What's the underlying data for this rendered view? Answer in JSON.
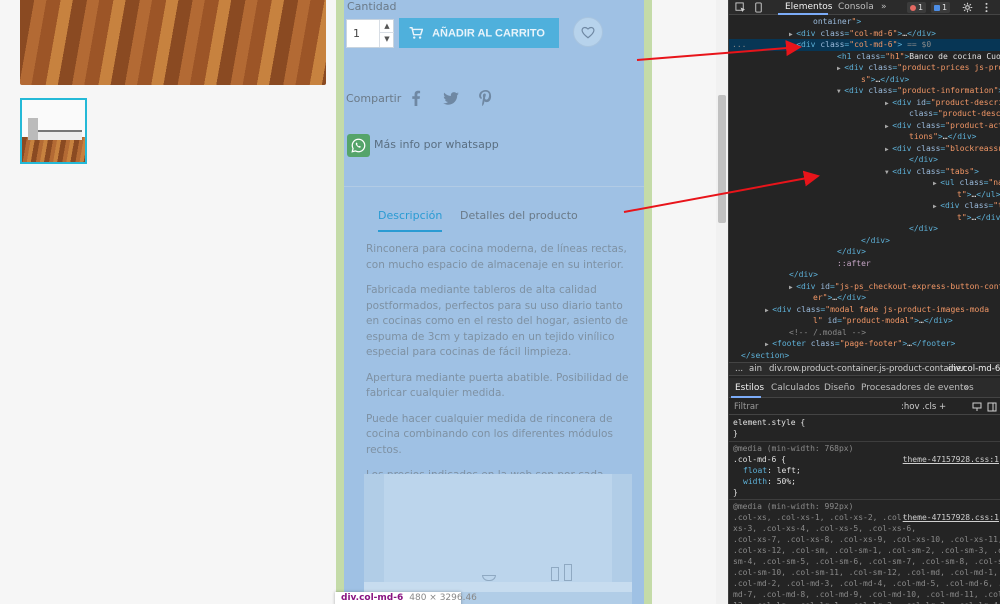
{
  "product": {
    "cantidad_label": "Cantidad",
    "quantity": "1",
    "add_to_cart": "AÑADIR AL CARRITO",
    "share_label": "Compartir",
    "whatsapp_label": "Más info por whatsapp",
    "tabs": [
      "Descripción",
      "Detalles del producto"
    ],
    "description": [
      "Rinconera para cocina moderna, de líneas rectas, con mucho espacio de almacenaje en su interior.",
      "Fabricada mediante tableros de alta calidad postformados, perfectos para su uso diario tanto en cocinas como en el resto del hogar, asiento de espuma de 3cm y tapizado en un tejido vinílico especial para cocinas de fácil limpieza.",
      "Apertura mediante puerta abatible. Posibilidad de fabricar cualquier medida.",
      "Puede hacer cualquier medida de rinconera de cocina combinando con los diferentes módulos rectos.",
      "Los precios indicados en la web son por cada módulo recto."
    ]
  },
  "tooltip": {
    "name": "div.col-md-6",
    "size": "480 × 3296.46"
  },
  "devtools": {
    "tabs": [
      "Elementos",
      "Consola",
      "»"
    ],
    "error_count": "1",
    "message_count": "1",
    "dom": [
      {
        "i": 14,
        "a": "",
        "parts": [
          [
            "attr",
            "ontainer"
          ],
          [
            "val",
            "\""
          ],
          [
            "tag",
            ">"
          ]
        ]
      },
      {
        "i": 10,
        "a": "▶",
        "parts": [
          [
            "tag",
            "<div "
          ],
          [
            "attr",
            "class"
          ],
          [
            "tag",
            "="
          ],
          [
            "val",
            "\"col-md-6\""
          ],
          [
            "tag",
            ">"
          ],
          [
            "txt",
            "…"
          ],
          [
            "tag",
            "</div>"
          ]
        ]
      },
      {
        "i": 10,
        "a": "▼",
        "sel": true,
        "pre": "...",
        "parts": [
          [
            "tag",
            "<div "
          ],
          [
            "attr",
            "class"
          ],
          [
            "tag",
            "="
          ],
          [
            "val",
            "\"col-md-6\""
          ],
          [
            "tag",
            ">"
          ],
          [
            "dim",
            " == $0"
          ]
        ]
      },
      {
        "i": 18,
        "a": "",
        "parts": [
          [
            "tag",
            "<h1 "
          ],
          [
            "attr",
            "class"
          ],
          [
            "tag",
            "="
          ],
          [
            "val",
            "\"h1\""
          ],
          [
            "tag",
            ">"
          ],
          [
            "txt",
            "Banco de cocina Cuore"
          ],
          [
            "tag",
            "</h1>"
          ]
        ]
      },
      {
        "i": 18,
        "a": "▶",
        "parts": [
          [
            "tag",
            "<div "
          ],
          [
            "attr",
            "class"
          ],
          [
            "tag",
            "="
          ],
          [
            "val",
            "\"product-prices js-product-price"
          ]
        ]
      },
      {
        "i": 22,
        "a": "",
        "parts": [
          [
            "val",
            "s\""
          ],
          [
            "tag",
            ">"
          ],
          [
            "txt",
            "…"
          ],
          [
            "tag",
            "</div>"
          ]
        ]
      },
      {
        "i": 18,
        "a": "▼",
        "parts": [
          [
            "tag",
            "<div "
          ],
          [
            "attr",
            "class"
          ],
          [
            "tag",
            "="
          ],
          [
            "val",
            "\"product-information\""
          ],
          [
            "tag",
            ">"
          ]
        ]
      },
      {
        "i": 26,
        "a": "▶",
        "parts": [
          [
            "tag",
            "<div "
          ],
          [
            "attr",
            "id"
          ],
          [
            "tag",
            "="
          ],
          [
            "val",
            "\"product-description-short-100\""
          ]
        ]
      },
      {
        "i": 30,
        "a": "",
        "parts": [
          [
            "attr",
            "class"
          ],
          [
            "tag",
            "="
          ],
          [
            "val",
            "\"product-description\""
          ],
          [
            "tag",
            ">"
          ],
          [
            "txt",
            "…"
          ],
          [
            "tag",
            "</div>"
          ]
        ]
      },
      {
        "i": 26,
        "a": "▶",
        "parts": [
          [
            "tag",
            "<div "
          ],
          [
            "attr",
            "class"
          ],
          [
            "tag",
            "="
          ],
          [
            "val",
            "\"product-actions js-product-ac"
          ]
        ]
      },
      {
        "i": 30,
        "a": "",
        "parts": [
          [
            "val",
            "tions\""
          ],
          [
            "tag",
            ">"
          ],
          [
            "txt",
            "…"
          ],
          [
            "tag",
            "</div>"
          ]
        ]
      },
      {
        "i": 26,
        "a": "▶",
        "parts": [
          [
            "tag",
            "<div "
          ],
          [
            "attr",
            "class"
          ],
          [
            "tag",
            "="
          ],
          [
            "val",
            "\"blockreassurance_product\""
          ],
          [
            "tag",
            ">"
          ],
          [
            "txt",
            "…"
          ]
        ]
      },
      {
        "i": 30,
        "a": "",
        "parts": [
          [
            "tag",
            "</div>"
          ]
        ]
      },
      {
        "i": 26,
        "a": "▼",
        "parts": [
          [
            "tag",
            "<div "
          ],
          [
            "attr",
            "class"
          ],
          [
            "tag",
            "="
          ],
          [
            "val",
            "\"tabs\""
          ],
          [
            "tag",
            ">"
          ]
        ]
      },
      {
        "i": 34,
        "a": "▶",
        "parts": [
          [
            "tag",
            "<ul "
          ],
          [
            "attr",
            "class"
          ],
          [
            "tag",
            "="
          ],
          [
            "val",
            "\"nav nav-tabs\""
          ],
          [
            "attr",
            " role"
          ],
          [
            "tag",
            "="
          ],
          [
            "val",
            "\"tablis"
          ]
        ]
      },
      {
        "i": 38,
        "a": "",
        "parts": [
          [
            "val",
            "t\""
          ],
          [
            "tag",
            ">"
          ],
          [
            "txt",
            "…"
          ],
          [
            "tag",
            "</ul>"
          ]
        ]
      },
      {
        "i": 34,
        "a": "▶",
        "parts": [
          [
            "tag",
            "<div "
          ],
          [
            "attr",
            "class"
          ],
          [
            "tag",
            "="
          ],
          [
            "val",
            "\"tab-content\""
          ],
          [
            "attr",
            " id"
          ],
          [
            "tag",
            "="
          ],
          [
            "val",
            "\"tab-conten"
          ]
        ]
      },
      {
        "i": 38,
        "a": "",
        "parts": [
          [
            "val",
            "t\""
          ],
          [
            "tag",
            ">"
          ],
          [
            "txt",
            "…"
          ],
          [
            "tag",
            "</div>"
          ]
        ]
      },
      {
        "i": 30,
        "a": "",
        "parts": [
          [
            "tag",
            "</div>"
          ]
        ]
      },
      {
        "i": 22,
        "a": "",
        "parts": [
          [
            "tag",
            "</div>"
          ]
        ]
      },
      {
        "i": 18,
        "a": "",
        "parts": [
          [
            "tag",
            "</div>"
          ]
        ]
      },
      {
        "i": 18,
        "a": "",
        "parts": [
          [
            "pseudo",
            "::after"
          ]
        ]
      },
      {
        "i": 10,
        "a": "",
        "parts": [
          [
            "tag",
            "</div>"
          ]
        ]
      },
      {
        "i": 10,
        "a": "▶",
        "parts": [
          [
            "tag",
            "<div "
          ],
          [
            "attr",
            "id"
          ],
          [
            "tag",
            "="
          ],
          [
            "val",
            "\"js-ps_checkout-express-button-container"
          ]
        ]
      },
      {
        "i": 14,
        "a": "",
        "parts": [
          [
            "val",
            "er\""
          ],
          [
            "tag",
            ">"
          ],
          [
            "txt",
            "…"
          ],
          [
            "tag",
            "</div>"
          ]
        ]
      },
      {
        "i": 6,
        "a": "▶",
        "parts": [
          [
            "tag",
            "<div "
          ],
          [
            "attr",
            "class"
          ],
          [
            "tag",
            "="
          ],
          [
            "val",
            "\"modal fade js-product-images-moda"
          ]
        ]
      },
      {
        "i": 14,
        "a": "",
        "parts": [
          [
            "val",
            "l\""
          ],
          [
            "attr",
            " id"
          ],
          [
            "tag",
            "="
          ],
          [
            "val",
            "\"product-modal\""
          ],
          [
            "tag",
            ">"
          ],
          [
            "txt",
            "…"
          ],
          [
            "tag",
            "</div>"
          ]
        ]
      },
      {
        "i": 10,
        "a": "",
        "parts": [
          [
            "comment",
            "<!-- /.modal -->"
          ]
        ]
      },
      {
        "i": 6,
        "a": "▶",
        "parts": [
          [
            "tag",
            "<footer "
          ],
          [
            "attr",
            "class"
          ],
          [
            "tag",
            "="
          ],
          [
            "val",
            "\"page-footer\""
          ],
          [
            "tag",
            ">"
          ],
          [
            "txt",
            "…"
          ],
          [
            "tag",
            "</footer>"
          ]
        ]
      },
      {
        "i": 2,
        "a": "",
        "parts": [
          [
            "tag",
            "</section>"
          ]
        ]
      }
    ],
    "breadcrumbs": [
      "...",
      "ain",
      "div.row.product-container.js-product-container",
      "div.col-md-6"
    ],
    "style_tabs": [
      "Estilos",
      "Calculados",
      "Diseño",
      "Procesadores de eventos",
      "»"
    ],
    "filter_placeholder": "Filtrar",
    "filter_tools": ":hov  .cls  +",
    "rules": {
      "element_style": "element.style {",
      "close": "}",
      "media1": "@media (min-width: 768px)",
      "rule1_selector": ".col-md-6 {",
      "rule1_link": "theme-47157928.css:1",
      "rule1_props": [
        [
          "float",
          "left;"
        ],
        [
          "width",
          "50%;"
        ]
      ],
      "media2": "@media (min-width: 992px)",
      "rule2_link": "theme-47157928.css:1",
      "rule2_lines": [
        ".col-xs, .col-xs-1, .col-xs-2, .col-",
        "xs-3, .col-xs-4, .col-xs-5, .col-xs-6,",
        ".col-xs-7, .col-xs-8, .col-xs-9, .col-xs-10, .col-xs-11,",
        ".col-xs-12, .col-sm, .col-sm-1, .col-sm-2, .col-sm-3, .col-",
        "sm-4, .col-sm-5, .col-sm-6, .col-sm-7, .col-sm-8, .col-sm-9,",
        ".col-sm-10, .col-sm-11, .col-sm-12, .col-md, .col-md-1,",
        ".col-md-2, .col-md-3, .col-md-4, .col-md-5, .col-md-6, .col-",
        "md-7, .col-md-8, .col-md-9, .col-md-10, .col-md-11, .col-md-",
        "12, .col-lg, .col-lg-1, .col-lg-2, .col-lg-3, .col-lg-4,",
        ".col-lg-5, .col-lg-6, .col-lg-7, .col-lg-8, .col-lg-9, .col-",
        "lg-10, .col-lg-11, .col-lg-12, .col-xl, .col-xl-1, .col-xl-"
      ]
    }
  }
}
